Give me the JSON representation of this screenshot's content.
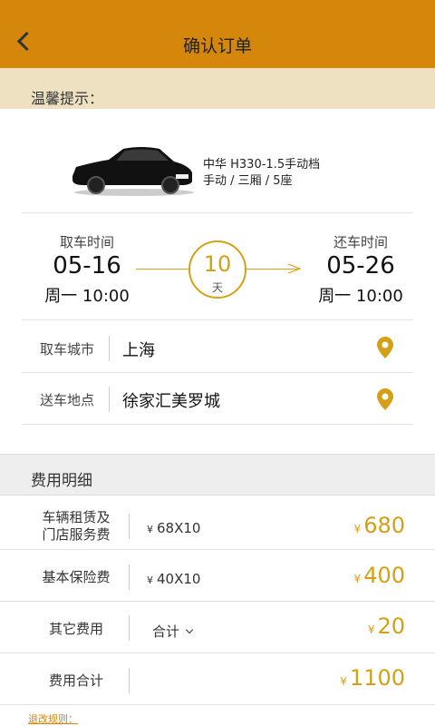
{
  "header": {
    "title": "确认订单"
  },
  "tip": {
    "label": "温馨提示："
  },
  "car": {
    "name": "中华 H330-1.5手动档",
    "spec": "手动 / 三厢 / 5座"
  },
  "pickup": {
    "label": "取车时间",
    "date": "05-16",
    "time": "周一 10:00"
  },
  "return": {
    "label": "还车时间",
    "date": "05-26",
    "time": "周一 10:00"
  },
  "duration": {
    "days": "10",
    "unit": "天"
  },
  "pickup_city": {
    "label": "取车城市",
    "value": "上海"
  },
  "delivery": {
    "label": "送车地点",
    "value": "徐家汇美罗城"
  },
  "fees": {
    "title": "费用明细",
    "currency": "¥",
    "rows": [
      {
        "label_line1": "车辆租赁及",
        "label_line2": "门店服务费",
        "formula": "68X10",
        "amount": "680"
      },
      {
        "label": "基本保险费",
        "formula": "40X10",
        "amount": "400"
      },
      {
        "label": "其它费用",
        "formula": "合计",
        "amount": "20"
      },
      {
        "label": "费用合计",
        "amount": "1100"
      }
    ]
  },
  "footer": {
    "rules": "退改规则："
  },
  "colors": {
    "header": "#d4870b",
    "accent": "#d4a017",
    "tip_bg": "#ede1c2"
  }
}
